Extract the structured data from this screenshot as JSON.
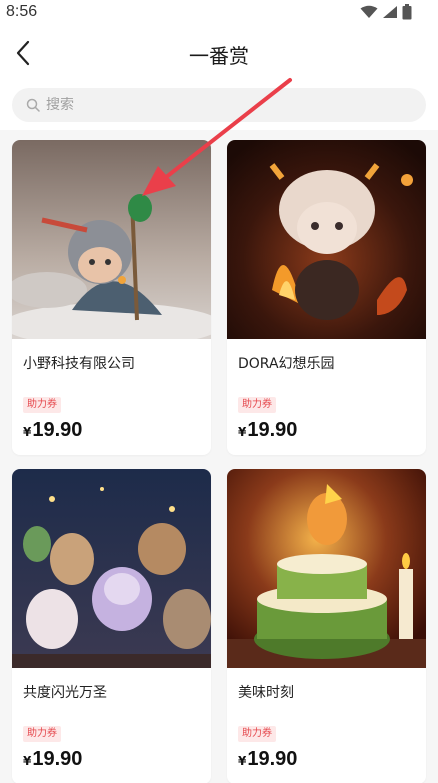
{
  "status": {
    "time": "8:56"
  },
  "header": {
    "title": "一番赏"
  },
  "search": {
    "placeholder": "搜索"
  },
  "products": [
    {
      "name": "小野科技有限公司",
      "badge": "助力券",
      "currency": "¥",
      "price": "19.90"
    },
    {
      "name": "DORA幻想乐园",
      "badge": "助力券",
      "currency": "¥",
      "price": "19.90"
    },
    {
      "name": "共度闪光万圣",
      "badge": "助力券",
      "currency": "¥",
      "price": "19.90"
    },
    {
      "name": "美味时刻",
      "badge": "助力券",
      "currency": "¥",
      "price": "19.90"
    }
  ],
  "colors": {
    "badge_text": "#e5484d",
    "badge_bg": "#fde8e8",
    "annotation_arrow": "#ea3f4a"
  }
}
